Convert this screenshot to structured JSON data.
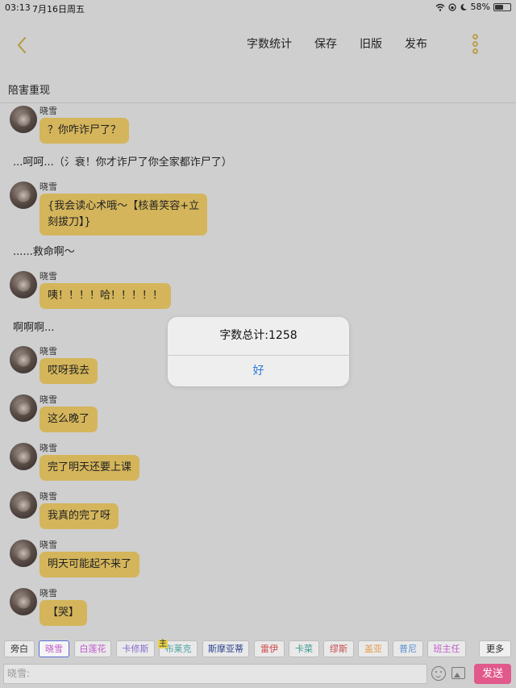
{
  "status": {
    "time": "03:13",
    "date": "7月16日周五",
    "battery": "58%",
    "battery_level": 0.58
  },
  "toolbar": {
    "word_count": "字数统计",
    "save": "保存",
    "old_version": "旧版",
    "publish": "发布"
  },
  "page_title": "陪害重现",
  "messages": [
    {
      "name": "晓雪",
      "text": "？你咋诈尸了？"
    },
    {
      "narration": "...呵呵...（氵衰！你才诈尸了你全家都诈尸了）"
    },
    {
      "name": "晓雪",
      "text_line1": "{我会读心术哦～【核善笑容+立",
      "text_line2": "刻拔刀】}"
    },
    {
      "narration": "......救命啊～"
    },
    {
      "name": "晓雪",
      "text": "咦！！！！哈！！！！！"
    },
    {
      "narration": "啊啊啊..."
    },
    {
      "name": "晓雪",
      "text": "哎呀我去"
    },
    {
      "name": "晓雪",
      "text": "这么晚了"
    },
    {
      "name": "晓雪",
      "text": "完了明天还要上课"
    },
    {
      "name": "晓雪",
      "text": "我真的完了呀"
    },
    {
      "name": "晓雪",
      "text": "明天可能起不来了"
    },
    {
      "name": "晓雪",
      "text": "【哭】"
    }
  ],
  "dialog": {
    "message": "字数总计:1258",
    "ok": "好"
  },
  "characters": [
    {
      "label": "旁白",
      "color": "#333333"
    },
    {
      "label": "晓雪",
      "color": "#c05ac8"
    },
    {
      "label": "白莲花",
      "color": "#c05ac8"
    },
    {
      "label": "卡修斯",
      "color": "#8a6ccf"
    },
    {
      "label": "布莱克",
      "color": "#4aa3a0"
    },
    {
      "label": "斯摩亚蒂",
      "color": "#2b3f8a"
    },
    {
      "label": "雷伊",
      "color": "#d04646"
    },
    {
      "label": "卡菜",
      "color": "#3c9a8c"
    },
    {
      "label": "缪斯",
      "color": "#c84d4d"
    },
    {
      "label": "盖亚",
      "color": "#e39a4a"
    },
    {
      "label": "普尼",
      "color": "#5a8fcf"
    },
    {
      "label": "班主任",
      "color": "#c05ac8"
    }
  ],
  "main_badge": "主",
  "more_label": "更多",
  "input": {
    "placeholder": "晓雪:"
  },
  "send_label": "发送"
}
